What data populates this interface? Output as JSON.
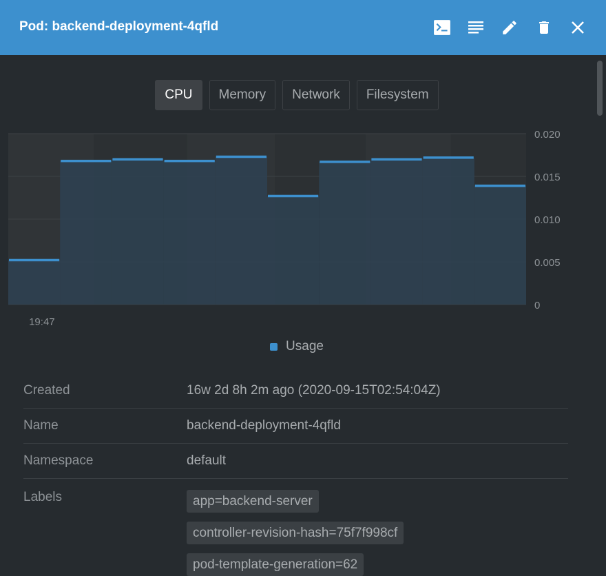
{
  "header": {
    "title": "Pod: backend-deployment-4qfld",
    "icons": [
      "terminal-icon",
      "logs-icon",
      "edit-icon",
      "delete-icon",
      "close-icon"
    ]
  },
  "tabs": [
    {
      "label": "CPU",
      "active": true
    },
    {
      "label": "Memory",
      "active": false
    },
    {
      "label": "Network",
      "active": false
    },
    {
      "label": "Filesystem",
      "active": false
    }
  ],
  "chart_data": {
    "type": "area",
    "categories": [
      "19:47",
      "",
      "",
      "",
      "",
      "",
      "",
      "",
      "",
      ""
    ],
    "series": [
      {
        "name": "Usage",
        "values": [
          0.0052,
          0.0168,
          0.017,
          0.0168,
          0.0173,
          0.0127,
          0.0167,
          0.017,
          0.0172,
          0.0139
        ]
      }
    ],
    "ylim": [
      0,
      0.02
    ],
    "yticks": [
      "0.020",
      "0.015",
      "0.010",
      "0.005",
      "0"
    ],
    "grid": true,
    "legend": "bottom",
    "colors": {
      "line": "#3d90ce",
      "fill": "#2e4252"
    }
  },
  "legend": {
    "label": "Usage",
    "color": "#3d90ce"
  },
  "details": {
    "created": {
      "label": "Created",
      "value": "16w 2d 8h 2m ago (2020-09-15T02:54:04Z)"
    },
    "name": {
      "label": "Name",
      "value": "backend-deployment-4qfld"
    },
    "namespace": {
      "label": "Namespace",
      "value": "default"
    },
    "labels": {
      "label": "Labels",
      "items": [
        "app=backend-server",
        "controller-revision-hash=75f7f998cf",
        "pod-template-generation=62"
      ]
    }
  },
  "colors": {
    "accent": "#3d90ce",
    "background": "#262b2f"
  }
}
